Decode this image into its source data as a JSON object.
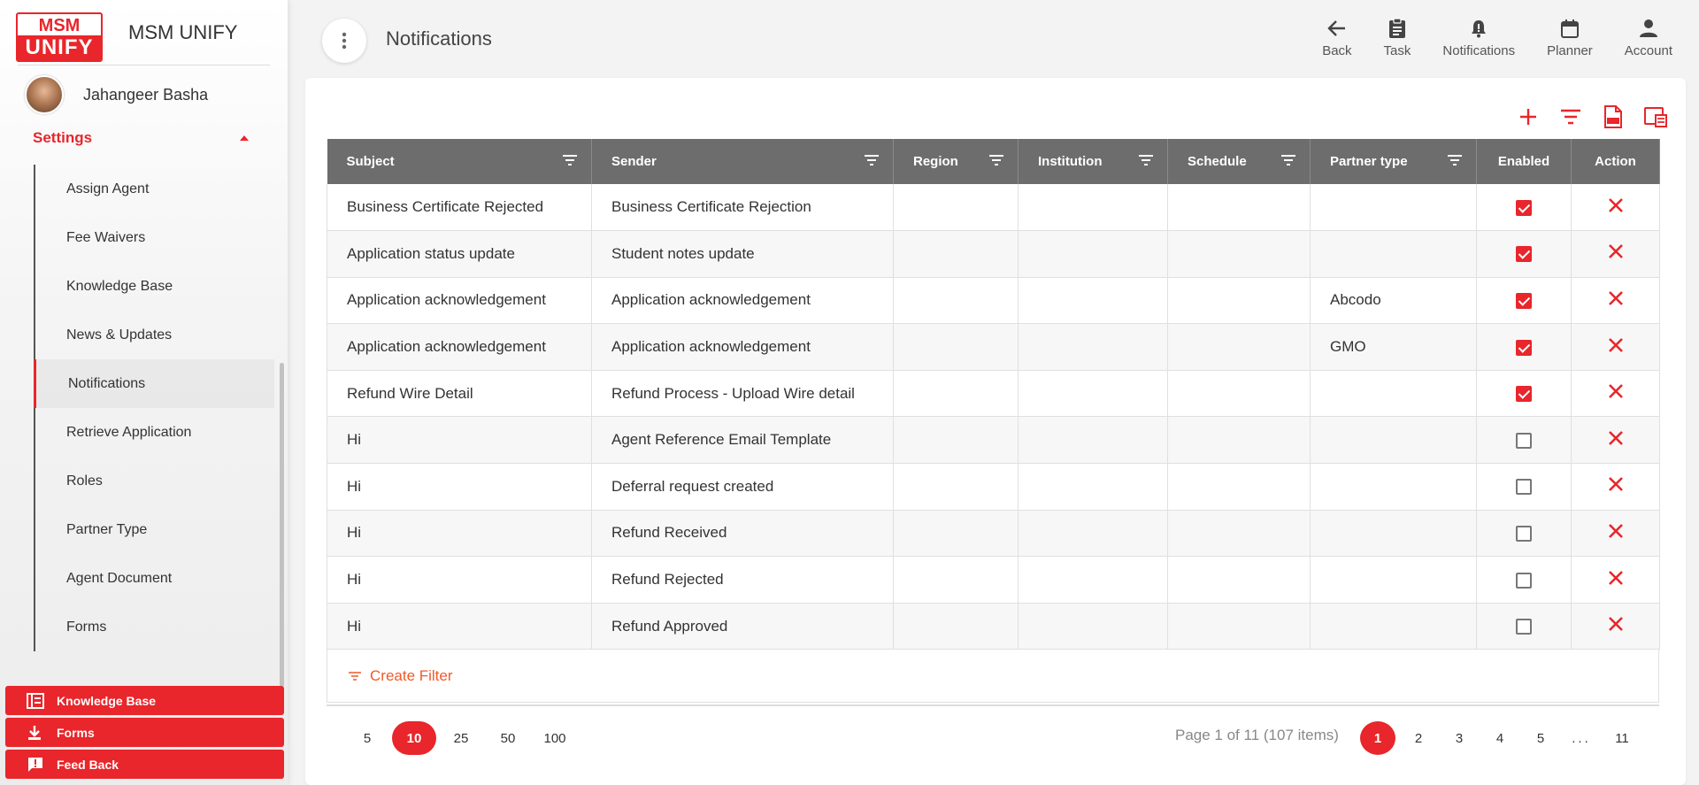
{
  "brand": {
    "logo_top": "MSM",
    "logo_bottom": "UNIFY",
    "name": "MSM UNIFY"
  },
  "user": {
    "name": "Jahangeer Basha"
  },
  "sidebar": {
    "section": "Settings",
    "items": [
      {
        "label": "Assign Agent"
      },
      {
        "label": "Fee Waivers"
      },
      {
        "label": "Knowledge Base"
      },
      {
        "label": "News & Updates"
      },
      {
        "label": "Notifications"
      },
      {
        "label": "Retrieve Application"
      },
      {
        "label": "Roles"
      },
      {
        "label": "Partner Type"
      },
      {
        "label": "Agent Document"
      },
      {
        "label": "Forms"
      }
    ],
    "active": "Notifications",
    "bottom_buttons": [
      {
        "label": "Knowledge Base",
        "icon": "book-icon"
      },
      {
        "label": "Forms",
        "icon": "download-icon"
      },
      {
        "label": "Feed Back",
        "icon": "feedback-icon"
      }
    ]
  },
  "page": {
    "title": "Notifications"
  },
  "topnav": {
    "back": "Back",
    "task": "Task",
    "notifications": "Notifications",
    "planner": "Planner",
    "account": "Account"
  },
  "colors": {
    "accent": "#e8262b",
    "header_bg": "#6d6d6d",
    "link_orange": "#f05a28"
  },
  "table": {
    "columns": [
      "Subject",
      "Sender",
      "Region",
      "Institution",
      "Schedule",
      "Partner type",
      "Enabled",
      "Action"
    ],
    "rows": [
      {
        "subject": "Business Certificate Rejected",
        "sender": "Business Certificate Rejection",
        "region": "",
        "institution": "",
        "schedule": "",
        "partner_type": "",
        "enabled": true
      },
      {
        "subject": "Application status update",
        "sender": "Student notes update",
        "region": "",
        "institution": "",
        "schedule": "",
        "partner_type": "",
        "enabled": true
      },
      {
        "subject": "Application acknowledgement",
        "sender": "Application acknowledgement",
        "region": "",
        "institution": "",
        "schedule": "",
        "partner_type": "Abcodo",
        "enabled": true
      },
      {
        "subject": "Application acknowledgement",
        "sender": "Application acknowledgement",
        "region": "",
        "institution": "",
        "schedule": "",
        "partner_type": "GMO",
        "enabled": true
      },
      {
        "subject": "Refund Wire Detail",
        "sender": "Refund Process - Upload Wire detail",
        "region": "",
        "institution": "",
        "schedule": "",
        "partner_type": "",
        "enabled": true
      },
      {
        "subject": "Hi",
        "sender": "Agent Reference Email Template",
        "region": "",
        "institution": "",
        "schedule": "",
        "partner_type": "",
        "enabled": false
      },
      {
        "subject": "Hi",
        "sender": "Deferral request created",
        "region": "",
        "institution": "",
        "schedule": "",
        "partner_type": "",
        "enabled": false
      },
      {
        "subject": "Hi",
        "sender": "Refund Received",
        "region": "",
        "institution": "",
        "schedule": "",
        "partner_type": "",
        "enabled": false
      },
      {
        "subject": "Hi",
        "sender": "Refund Rejected",
        "region": "",
        "institution": "",
        "schedule": "",
        "partner_type": "",
        "enabled": false
      },
      {
        "subject": "Hi",
        "sender": "Refund Approved",
        "region": "",
        "institution": "",
        "schedule": "",
        "partner_type": "",
        "enabled": false
      }
    ]
  },
  "filter": {
    "create_label": "Create Filter"
  },
  "pager": {
    "sizes": [
      "5",
      "10",
      "25",
      "50",
      "100"
    ],
    "selected_size": "10",
    "info": "Page 1 of 11 (107 items)",
    "pages": [
      "1",
      "2",
      "3",
      "4",
      "5",
      "...",
      "11"
    ],
    "current": "1"
  }
}
